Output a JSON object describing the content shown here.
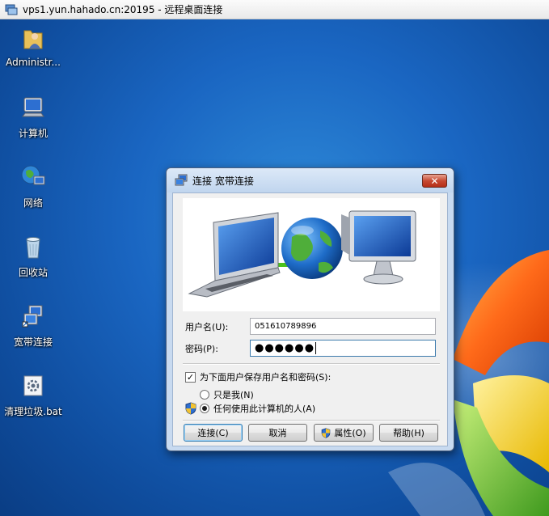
{
  "window": {
    "title": "vps1.yun.hahado.cn:20195 - 远程桌面连接"
  },
  "desktop": {
    "icons": [
      {
        "label": "Administr...",
        "icon": "user-folder-icon"
      },
      {
        "label": "计算机",
        "icon": "computer-icon"
      },
      {
        "label": "网络",
        "icon": "network-icon"
      },
      {
        "label": "回收站",
        "icon": "recycle-bin-icon"
      },
      {
        "label": "宽带连接",
        "icon": "broadband-connection-icon"
      },
      {
        "label": "清理垃圾.bat",
        "icon": "batch-file-icon"
      }
    ]
  },
  "dialog": {
    "title": "连接 宽带连接",
    "close_label": "✕",
    "username_label": "用户名(U):",
    "username_value": "051610789896",
    "password_label": "密码(P):",
    "password_value": "●●●●●●",
    "save_credentials_label": "为下面用户保存用户名和密码(S):",
    "save_credentials_checked": true,
    "options": [
      {
        "label": "只是我(N)",
        "selected": false
      },
      {
        "label": "任何使用此计算机的人(A)",
        "selected": true
      }
    ],
    "buttons": {
      "connect": "连接(C)",
      "cancel": "取消",
      "properties": "属性(O)",
      "help": "帮助(H)"
    }
  },
  "colors": {
    "desktop_blue": "#1a66c2",
    "dialog_frame": "#c8daf0",
    "close_red": "#c74a33"
  }
}
